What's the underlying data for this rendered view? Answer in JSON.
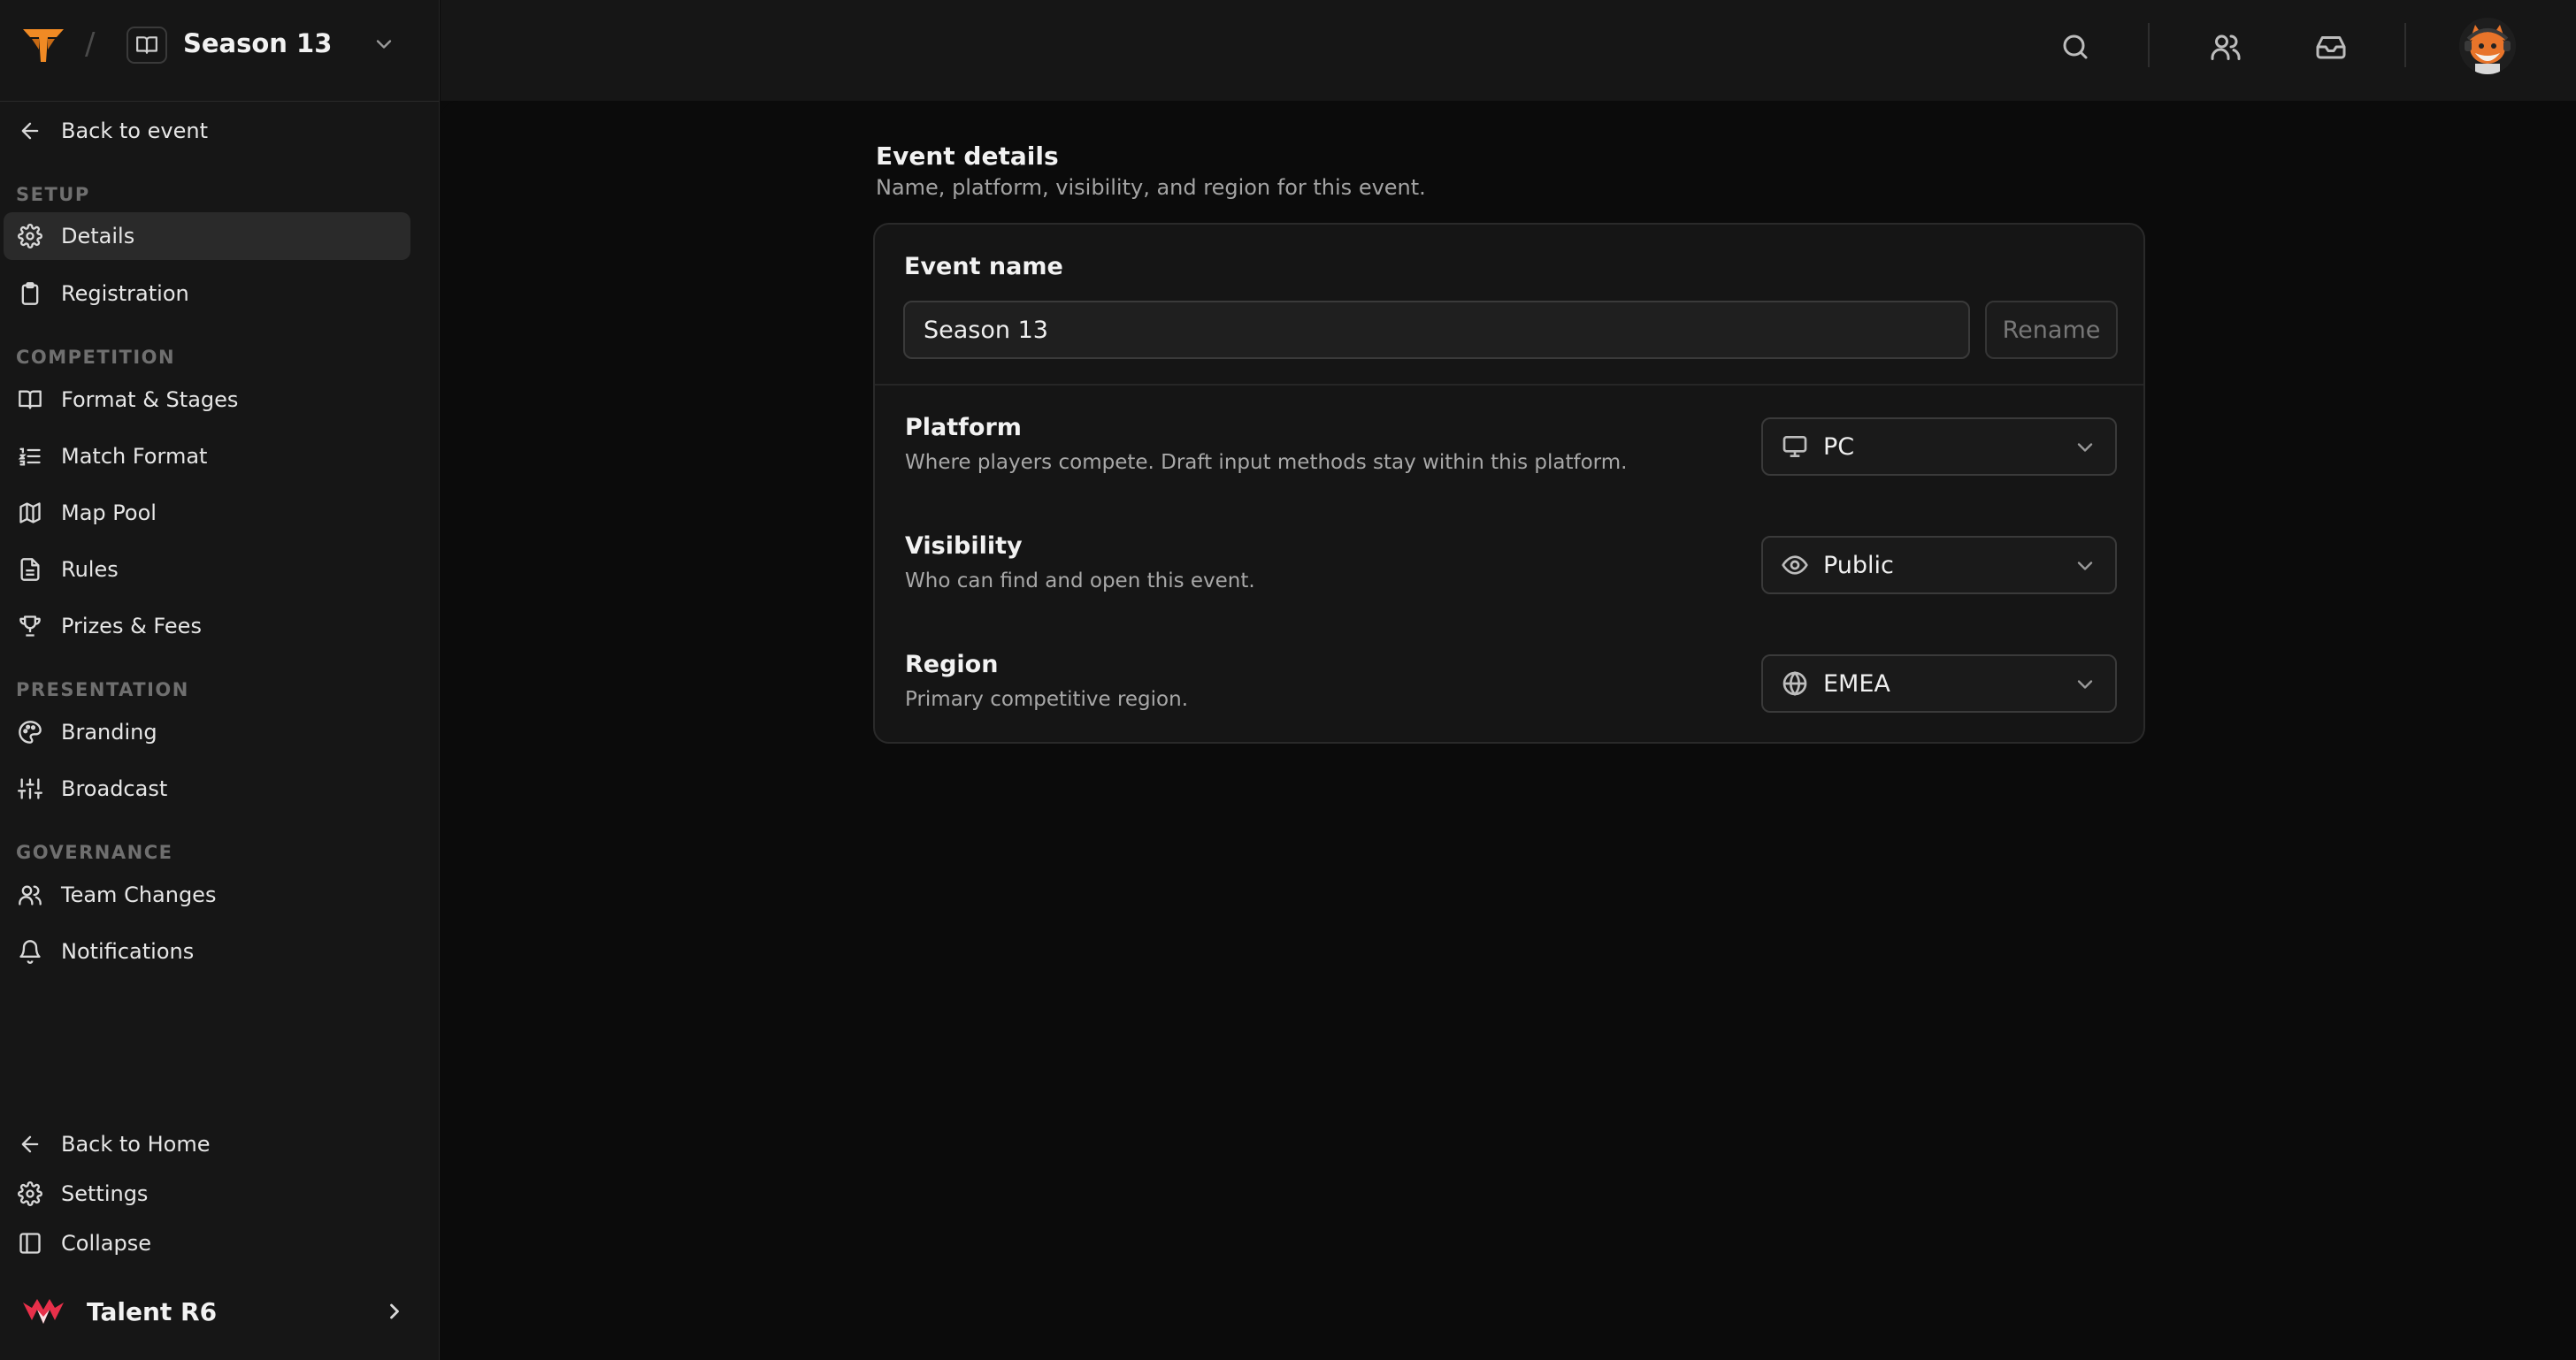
{
  "header": {
    "event_title": "Season 13",
    "separator": "/"
  },
  "sidebar": {
    "back_to_event": "Back to event",
    "sections": [
      {
        "label": "SETUP",
        "items": [
          {
            "label": "Details",
            "icon": "gear-icon",
            "active": true
          },
          {
            "label": "Registration",
            "icon": "clipboard-icon"
          }
        ]
      },
      {
        "label": "COMPETITION",
        "items": [
          {
            "label": "Format & Stages",
            "icon": "book-icon"
          },
          {
            "label": "Match Format",
            "icon": "list-icon"
          },
          {
            "label": "Map Pool",
            "icon": "map-icon"
          },
          {
            "label": "Rules",
            "icon": "document-icon"
          },
          {
            "label": "Prizes & Fees",
            "icon": "trophy-icon"
          }
        ]
      },
      {
        "label": "PRESENTATION",
        "items": [
          {
            "label": "Branding",
            "icon": "palette-icon"
          },
          {
            "label": "Broadcast",
            "icon": "sliders-icon"
          }
        ]
      },
      {
        "label": "GOVERNANCE",
        "items": [
          {
            "label": "Team Changes",
            "icon": "users-icon"
          },
          {
            "label": "Notifications",
            "icon": "bell-icon"
          }
        ]
      }
    ],
    "footer": {
      "back_home": "Back to Home",
      "settings": "Settings",
      "collapse": "Collapse"
    },
    "workspace": {
      "name": "Talent R6"
    }
  },
  "topbar": {
    "icons": [
      "search-icon",
      "users-icon",
      "inbox-icon"
    ]
  },
  "page": {
    "title": "Event details",
    "subtitle": "Name, platform, visibility, and region for this event."
  },
  "form": {
    "event_name": {
      "label": "Event name",
      "value": "Season 13",
      "rename_label": "Rename"
    },
    "platform": {
      "title": "Platform",
      "description": "Where players compete. Draft input methods stay within this platform.",
      "value": "PC"
    },
    "visibility": {
      "title": "Visibility",
      "description": "Who can find and open this event.",
      "value": "Public"
    },
    "region": {
      "title": "Region",
      "description": "Primary competitive region.",
      "value": "EMEA"
    }
  },
  "colors": {
    "brand_orange": "#f08a24",
    "workspace_red": "#e8304a",
    "active_item_bg": "#2a2a2a"
  }
}
